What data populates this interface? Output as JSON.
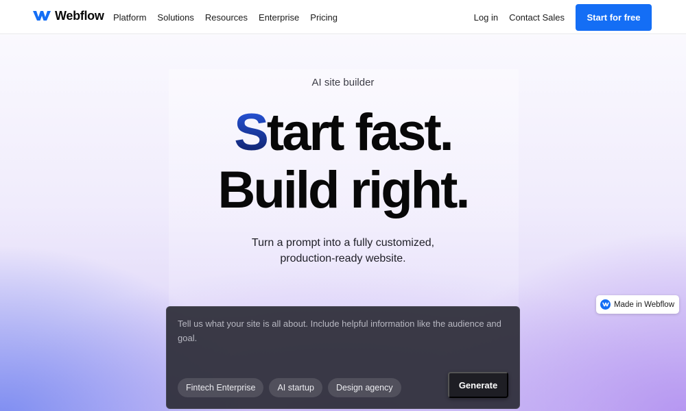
{
  "brand": {
    "name": "Webflow",
    "logo_icon": "webflow-logo-icon",
    "accent_color": "#146ef5"
  },
  "nav": {
    "items": [
      {
        "label": "Platform"
      },
      {
        "label": "Solutions"
      },
      {
        "label": "Resources"
      },
      {
        "label": "Enterprise"
      },
      {
        "label": "Pricing"
      }
    ],
    "login_label": "Log in",
    "contact_label": "Contact Sales",
    "cta_label": "Start for free"
  },
  "hero": {
    "eyebrow": "AI site builder",
    "headline_accent": "S",
    "headline_line1_rest": "tart fast.",
    "headline_line2": "Build right.",
    "subhead_line1": "Turn a prompt into a fully customized,",
    "subhead_line2": "production-ready website."
  },
  "prompt": {
    "placeholder": "Tell us what your site is all about. Include helpful information like the audience and goal.",
    "value": "",
    "chips": [
      {
        "label": "Fintech Enterprise"
      },
      {
        "label": "AI startup"
      },
      {
        "label": "Design agency"
      }
    ],
    "generate_label": "Generate"
  },
  "badge": {
    "label": "Made in Webflow",
    "icon": "webflow-logo-icon"
  }
}
